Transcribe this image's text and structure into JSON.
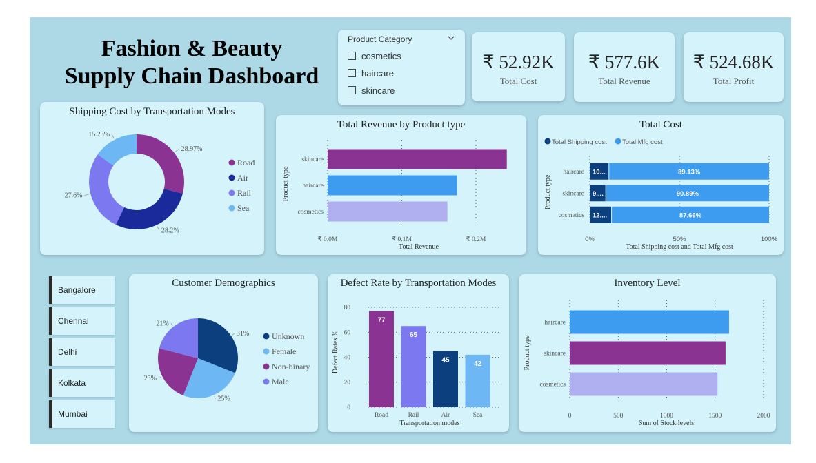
{
  "header": {
    "title_line1": "Fashion & Beauty",
    "title_line2": "Supply Chain Dashboard"
  },
  "slicer": {
    "label": "Product Category",
    "options": [
      "cosmetics",
      "haircare",
      "skincare"
    ]
  },
  "kpis": [
    {
      "value": "₹ 52.92K",
      "label": "Total Cost"
    },
    {
      "value": "₹ 577.6K",
      "label": "Total Revenue"
    },
    {
      "value": "₹ 524.68K",
      "label": "Total Profit"
    }
  ],
  "cities": [
    "Bangalore",
    "Chennai",
    "Delhi",
    "Kolkata",
    "Mumbai"
  ],
  "colors": {
    "purple": "#8b3393",
    "navy": "#1a2a9a",
    "periwinkle": "#7b78f0",
    "skyblue": "#6cb7f4",
    "darkblue": "#0b3f7e",
    "blue": "#3e9cf0",
    "lavender": "#b0b0f0"
  },
  "chart_data": [
    {
      "type": "pie",
      "variant": "donut",
      "title": "Shipping Cost by Transportation Modes",
      "categories": [
        "Road",
        "Air",
        "Rail",
        "Sea"
      ],
      "values": [
        28.97,
        28.2,
        27.6,
        15.23
      ],
      "labels": [
        "28.97%",
        "28.2%",
        "27.6%",
        "15.23%"
      ],
      "legend": "right"
    },
    {
      "type": "bar",
      "orientation": "horizontal",
      "title": "Total Revenue by Product type",
      "categories": [
        "skincare",
        "haircare",
        "cosmetics"
      ],
      "values": [
        241628,
        174455,
        161521
      ],
      "xlabel": "Total Revenue",
      "ylabel": "Product type",
      "xticks": [
        "₹ 0.0M",
        "₹ 0.1M",
        "₹ 0.2M"
      ],
      "xlim": [
        0,
        0.24
      ]
    },
    {
      "type": "bar",
      "orientation": "horizontal",
      "stacked": "100%",
      "title": "Total Cost",
      "categories": [
        "haircare",
        "skincare",
        "cosmetics"
      ],
      "series": [
        {
          "name": "Total Shipping cost",
          "values": [
            10.87,
            9.11,
            12.34
          ],
          "labels": [
            "10...",
            "9....",
            "12...."
          ]
        },
        {
          "name": "Total Mfg cost",
          "values": [
            89.13,
            90.89,
            87.66
          ],
          "labels": [
            "89.13%",
            "90.89%",
            "87.66%"
          ]
        }
      ],
      "xlabel": "Total Shipping cost and Total Mfg cost",
      "ylabel": "Product type",
      "xticks": [
        "0%",
        "50%",
        "100%"
      ],
      "legend": "top-left"
    },
    {
      "type": "pie",
      "title": "Customer Demographics",
      "categories": [
        "Unknown",
        "Female",
        "Non-binary",
        "Male"
      ],
      "values": [
        31,
        25,
        23,
        21
      ],
      "labels": [
        "31%",
        "25%",
        "23%",
        "21%"
      ],
      "legend": "right"
    },
    {
      "type": "bar",
      "title": "Defect Rate by Transportation Modes",
      "categories": [
        "Road",
        "Rail",
        "Air",
        "Sea"
      ],
      "values": [
        77,
        65,
        45,
        42
      ],
      "xlabel": "Transportation modes",
      "ylabel": "Defect Rates %",
      "ylim": [
        0,
        80
      ],
      "yticks": [
        0,
        20,
        40,
        60,
        80
      ]
    },
    {
      "type": "bar",
      "orientation": "horizontal",
      "title": "Inventory Level",
      "categories": [
        "haircare",
        "skincare",
        "cosmetics"
      ],
      "values": [
        1644,
        1608,
        1525
      ],
      "xlabel": "Sum of Stock levels",
      "ylabel": "Product type",
      "xlim": [
        0,
        2000
      ],
      "xticks": [
        0,
        500,
        1000,
        1500,
        2000
      ]
    }
  ]
}
